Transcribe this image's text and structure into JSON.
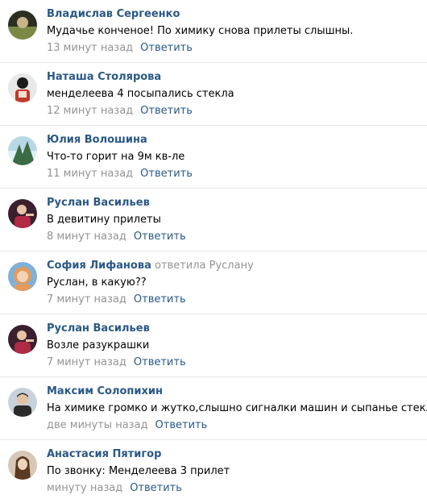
{
  "comments": [
    {
      "author": "Владислав Сергеенко",
      "text": "Мудачье конченое! По химику снова прилеты слышны.",
      "time": "13 минут назад",
      "reply_label": "Ответить",
      "avatar_colors": [
        "#2b2f22",
        "#7a8a45",
        "#c9b38a"
      ]
    },
    {
      "author": "Наташа Столярова",
      "text": "менделеева 4 посыпались стекла",
      "time": "12 минут назад",
      "reply_label": "Ответить",
      "avatar_colors": [
        "#e8e8e8",
        "#1b1b1b",
        "#c0392b"
      ]
    },
    {
      "author": "Юлия Волошина",
      "text": "Что-то горит на 9м кв-ле",
      "time": "11 минут назад",
      "reply_label": "Ответить",
      "avatar_colors": [
        "#b8d8e8",
        "#3b6b45",
        "#e0eef5"
      ]
    },
    {
      "author": "Руслан Васильев",
      "text": "В девитину прилеты",
      "time": "8 минут назад",
      "reply_label": "Ответить",
      "avatar_colors": [
        "#3a1f2e",
        "#b02a45",
        "#e6c2a8"
      ]
    },
    {
      "author": "София Лифанова",
      "reply_to_prefix": "ответила",
      "reply_to_name": "Руслану",
      "text": "Руслан, в какую??",
      "time": "7 минут назад",
      "reply_label": "Ответить",
      "avatar_colors": [
        "#7fb0d8",
        "#e39a5a",
        "#f3d2b8"
      ]
    },
    {
      "author": "Руслан Васильев",
      "text": "Возле разукрашки",
      "time": "7 минут назад",
      "reply_label": "Ответить",
      "avatar_colors": [
        "#3a1f2e",
        "#b02a45",
        "#e6c2a8"
      ]
    },
    {
      "author": "Максим Солопихин",
      "text": "На химике громко и жутко,слышно сигналки машин и сыпанье стекл",
      "time": "две минуты назад",
      "reply_label": "Ответить",
      "avatar_colors": [
        "#c9d2da",
        "#2c2c2c",
        "#e1c2a5"
      ]
    },
    {
      "author": "Анастасия Пятигор",
      "text": "По звонку: Менделеева 3 прилет",
      "time": "минуту назад",
      "reply_label": "Ответить",
      "avatar_colors": [
        "#d6c7b6",
        "#5a3a22",
        "#edd3bd"
      ]
    }
  ]
}
